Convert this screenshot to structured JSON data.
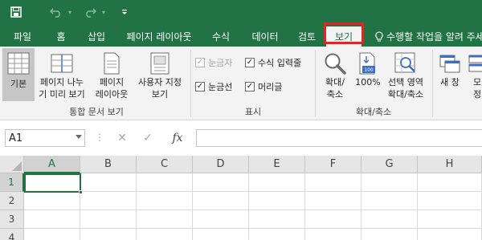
{
  "qat": {
    "save_icon": "save-icon",
    "undo_icon": "undo-icon",
    "redo_icon": "redo-icon",
    "customize_icon": "customize-qat-icon"
  },
  "tabs": [
    {
      "label": "파일",
      "active": false
    },
    {
      "label": "홈",
      "active": false
    },
    {
      "label": "삽입",
      "active": false
    },
    {
      "label": "페이지 레이아웃",
      "active": false
    },
    {
      "label": "수식",
      "active": false
    },
    {
      "label": "데이터",
      "active": false
    },
    {
      "label": "검토",
      "active": false
    },
    {
      "label": "보기",
      "active": true
    }
  ],
  "tell_me": "수행할 작업을 알려 주세요",
  "ribbon": {
    "workbook_views": {
      "group_label": "통합 문서 보기",
      "normal": "기본",
      "page_break_l1": "페이지 나누",
      "page_break_l2": "기 미리 보기",
      "page_layout_l1": "페이지",
      "page_layout_l2": "레이아웃",
      "custom_views_l1": "사용자 지정",
      "custom_views_l2": "보기"
    },
    "show": {
      "group_label": "표시",
      "ruler": "눈금자",
      "formula_bar": "수식 입력줄",
      "gridlines": "눈금선",
      "headings": "머리글",
      "check_mark": "✓"
    },
    "zoom": {
      "group_label": "확대/축소",
      "zoom_l1": "확대/",
      "zoom_l2": "축소",
      "hundred": "100%",
      "hundred_badge": "100",
      "to_selection_l1": "선택 영역",
      "to_selection_l2": "확대/축소"
    },
    "window": {
      "new_window": "새 창",
      "arrange_l1": "모",
      "arrange_l2": "정"
    }
  },
  "formula_bar": {
    "name_box": "A1",
    "dots": "⋮",
    "cancel": "✕",
    "enter": "✓",
    "fx": "fx",
    "value": ""
  },
  "grid": {
    "columns": [
      "A",
      "B",
      "C",
      "D",
      "E",
      "F",
      "G",
      "H"
    ],
    "rows": [
      "1",
      "2",
      "3",
      "4"
    ],
    "active_cell": "A1"
  },
  "colors": {
    "accent": "#217346",
    "highlight_box": "#e8231f"
  }
}
